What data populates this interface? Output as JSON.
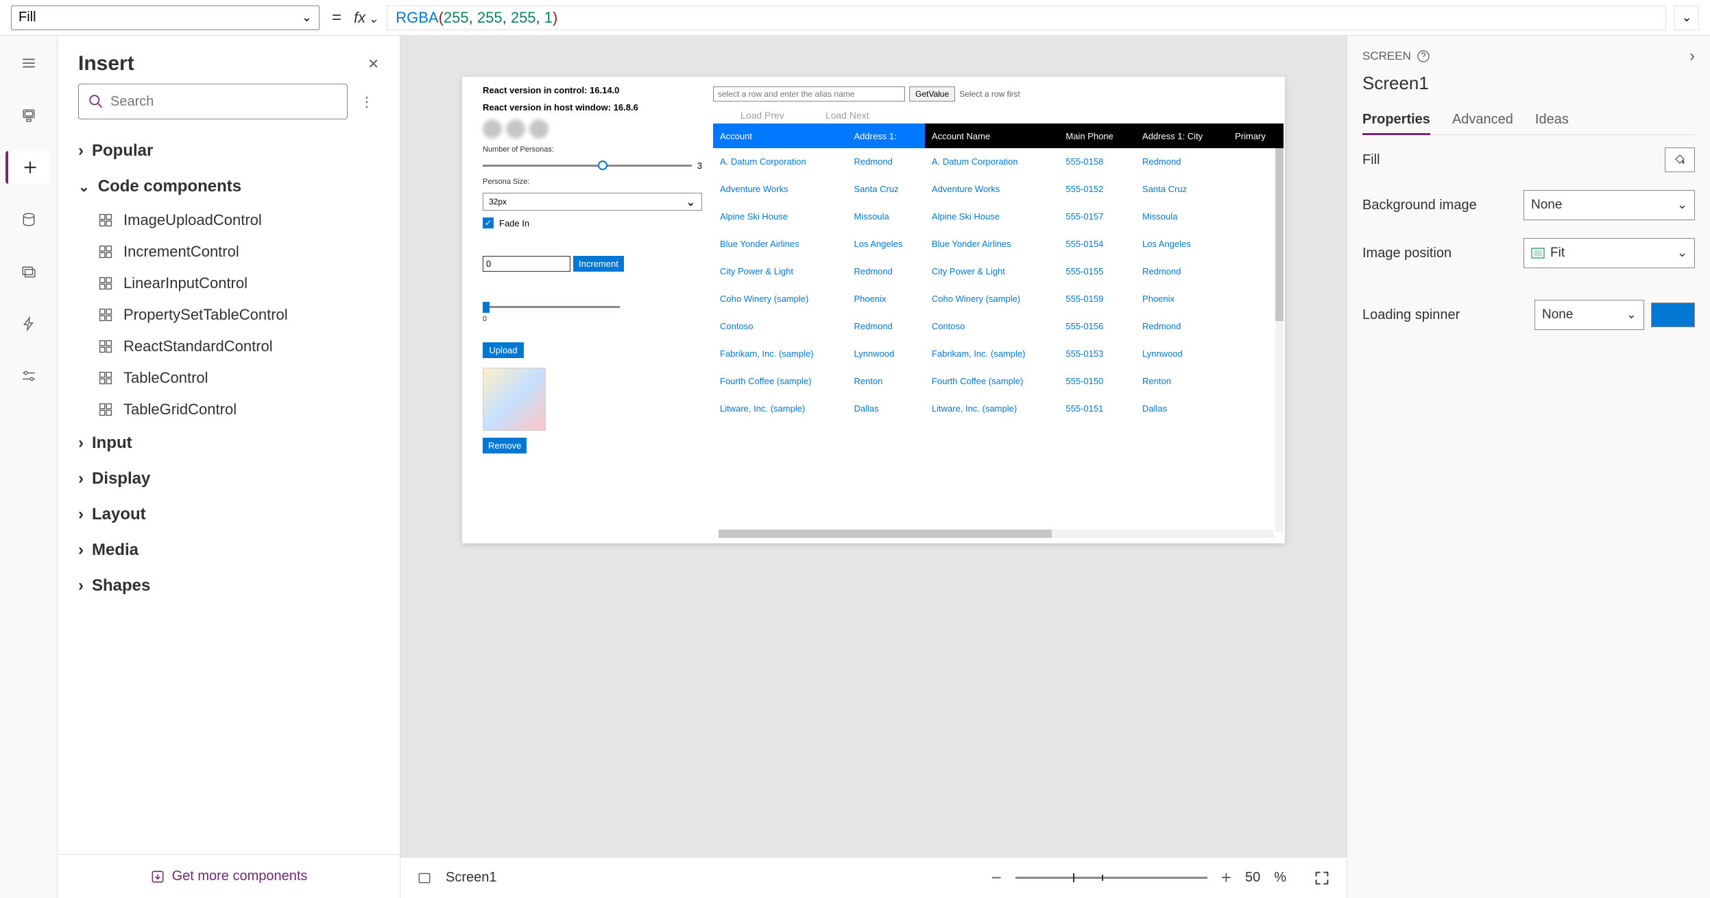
{
  "formula": {
    "property": "Fill",
    "fx_label": "fx",
    "expression_fn": "RGBA",
    "expression_args": [
      "255",
      "255",
      "255",
      "1"
    ]
  },
  "rail": {
    "items": [
      "hamburger",
      "tree",
      "insert",
      "data",
      "media",
      "power",
      "settings"
    ]
  },
  "insertPanel": {
    "title": "Insert",
    "search_placeholder": "Search",
    "groups": {
      "popular": "Popular",
      "code_components": "Code components",
      "input": "Input",
      "display": "Display",
      "layout": "Layout",
      "media": "Media",
      "shapes": "Shapes"
    },
    "code_components_items": [
      "ImageUploadControl",
      "IncrementControl",
      "LinearInputControl",
      "PropertySetTableControl",
      "ReactStandardControl",
      "TableControl",
      "TableGridControl"
    ],
    "footer": "Get more components"
  },
  "canvas": {
    "react_control": "React version in control: 16.14.0",
    "react_host": "React version in host window: 16.8.6",
    "num_personas_label": "Number of Personas:",
    "num_personas_value": "3",
    "persona_size_label": "Persona Size:",
    "persona_size_value": "32px",
    "fade_in_label": "Fade In",
    "increment_value": "0",
    "increment_btn": "Increment",
    "slider_val": "0",
    "upload_btn": "Upload",
    "remove_btn": "Remove",
    "alias_placeholder": "select a row and enter the alias name",
    "getvalue_btn": "GetValue",
    "select_hint": "Select a row first",
    "load_prev": "Load Prev",
    "load_next": "Load Next",
    "columns": [
      "Account",
      "Address 1:",
      "Account Name",
      "Main Phone",
      "Address 1: City",
      "Primary"
    ],
    "rows": [
      [
        "A. Datum Corporation",
        "Redmond",
        "A. Datum Corporation",
        "555-0158",
        "Redmond"
      ],
      [
        "Adventure Works",
        "Santa Cruz",
        "Adventure Works",
        "555-0152",
        "Santa Cruz"
      ],
      [
        "Alpine Ski House",
        "Missoula",
        "Alpine Ski House",
        "555-0157",
        "Missoula"
      ],
      [
        "Blue Yonder Airlines",
        "Los Angeles",
        "Blue Yonder Airlines",
        "555-0154",
        "Los Angeles"
      ],
      [
        "City Power & Light",
        "Redmond",
        "City Power & Light",
        "555-0155",
        "Redmond"
      ],
      [
        "Coho Winery (sample)",
        "Phoenix",
        "Coho Winery (sample)",
        "555-0159",
        "Phoenix"
      ],
      [
        "Contoso",
        "Redmond",
        "Contoso",
        "555-0156",
        "Redmond"
      ],
      [
        "Fabrikam, Inc. (sample)",
        "Lynnwood",
        "Fabrikam, Inc. (sample)",
        "555-0153",
        "Lynnwood"
      ],
      [
        "Fourth Coffee (sample)",
        "Renton",
        "Fourth Coffee (sample)",
        "555-0150",
        "Renton"
      ],
      [
        "Litware, Inc. (sample)",
        "Dallas",
        "Litware, Inc. (sample)",
        "555-0151",
        "Dallas"
      ]
    ],
    "footer_screen": "Screen1",
    "zoom_pct": "50",
    "zoom_pct_suffix": "%"
  },
  "propsPanel": {
    "header_label": "SCREEN",
    "screen_name": "Screen1",
    "tabs": [
      "Properties",
      "Advanced",
      "Ideas"
    ],
    "fill_label": "Fill",
    "bg_image_label": "Background image",
    "bg_image_value": "None",
    "image_pos_label": "Image position",
    "image_pos_value": "Fit",
    "spinner_label": "Loading spinner",
    "spinner_value": "None"
  }
}
